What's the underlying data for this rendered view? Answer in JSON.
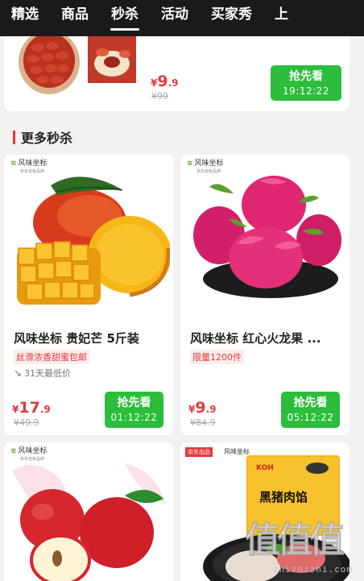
{
  "nav": {
    "tabs": [
      {
        "label": "精选",
        "active": false
      },
      {
        "label": "商品",
        "active": false
      },
      {
        "label": "秒杀",
        "active": true
      },
      {
        "label": "活动",
        "active": false
      },
      {
        "label": "买家秀",
        "active": false
      },
      {
        "label": "上",
        "active": false
      }
    ]
  },
  "top_product": {
    "price_symbol": "¥",
    "price_int": "9",
    "price_dec": ".9",
    "original_price": "¥99",
    "button_label": "抢先看",
    "countdown": "19:12:22"
  },
  "section": {
    "title": "更多秒杀"
  },
  "products": [
    {
      "brand": "风味坐标",
      "brand_sub": "京东自有品牌",
      "title": "风味坐标 贵妃芒 5斤装",
      "tagline": "丝滑浓香甜蜜包邮",
      "lowest": "31天最低价",
      "price_symbol": "¥",
      "price_int": "17",
      "price_dec": ".9",
      "original_price": "¥49.9",
      "button_label": "抢先看",
      "countdown": "01:12:22"
    },
    {
      "brand": "风味坐标",
      "brand_sub": "京东自有品牌",
      "title": "风味坐标 红心火龙果 ...",
      "tagline": "限量1200件",
      "price_symbol": "¥",
      "price_int": "9",
      "price_dec": ".9",
      "original_price": "¥84.9",
      "button_label": "抢先看",
      "countdown": "05:12:22"
    },
    {
      "brand": "风味坐标",
      "brand_sub": "京东自有品牌"
    },
    {
      "jd_tag": "京东出品",
      "brand": "风味坐标",
      "package_brand": "KOH",
      "package_text": "黑猪肉馅"
    }
  ],
  "watermark": {
    "glyphs": "值值值",
    "url": "zhizhizhi.com"
  },
  "colors": {
    "accent_red": "#e4393c",
    "button_green": "#2cbd3c",
    "nav_bg": "#1a1a1a"
  }
}
